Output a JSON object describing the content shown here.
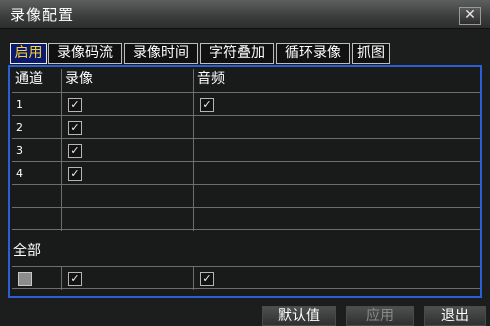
{
  "window": {
    "title": "录像配置"
  },
  "icons": {
    "close": "close-icon",
    "check": "checkmark-icon"
  },
  "colors": {
    "active_tab_bg": "#0a1a6e",
    "active_tab_text": "#ffd426",
    "panel_border": "#2a5fd6"
  },
  "tabs": [
    {
      "label": "启用",
      "active": true
    },
    {
      "label": "录像码流",
      "active": false
    },
    {
      "label": "录像时间",
      "active": false
    },
    {
      "label": "字符叠加",
      "active": false
    },
    {
      "label": "循环录像",
      "active": false
    },
    {
      "label": "抓图",
      "active": false
    }
  ],
  "table": {
    "headers": [
      "通道",
      "录像",
      "音频"
    ],
    "rows": [
      {
        "channel": "1",
        "record": true,
        "audio": true
      },
      {
        "channel": "2",
        "record": true,
        "audio": false
      },
      {
        "channel": "3",
        "record": true,
        "audio": false
      },
      {
        "channel": "4",
        "record": true,
        "audio": false
      },
      {
        "channel": "",
        "record": null,
        "audio": null
      },
      {
        "channel": "",
        "record": null,
        "audio": null
      }
    ]
  },
  "all": {
    "label": "全部",
    "channel": false,
    "record": true,
    "audio": true
  },
  "buttons": {
    "default": "默认值",
    "apply": "应用",
    "exit": "退出"
  }
}
